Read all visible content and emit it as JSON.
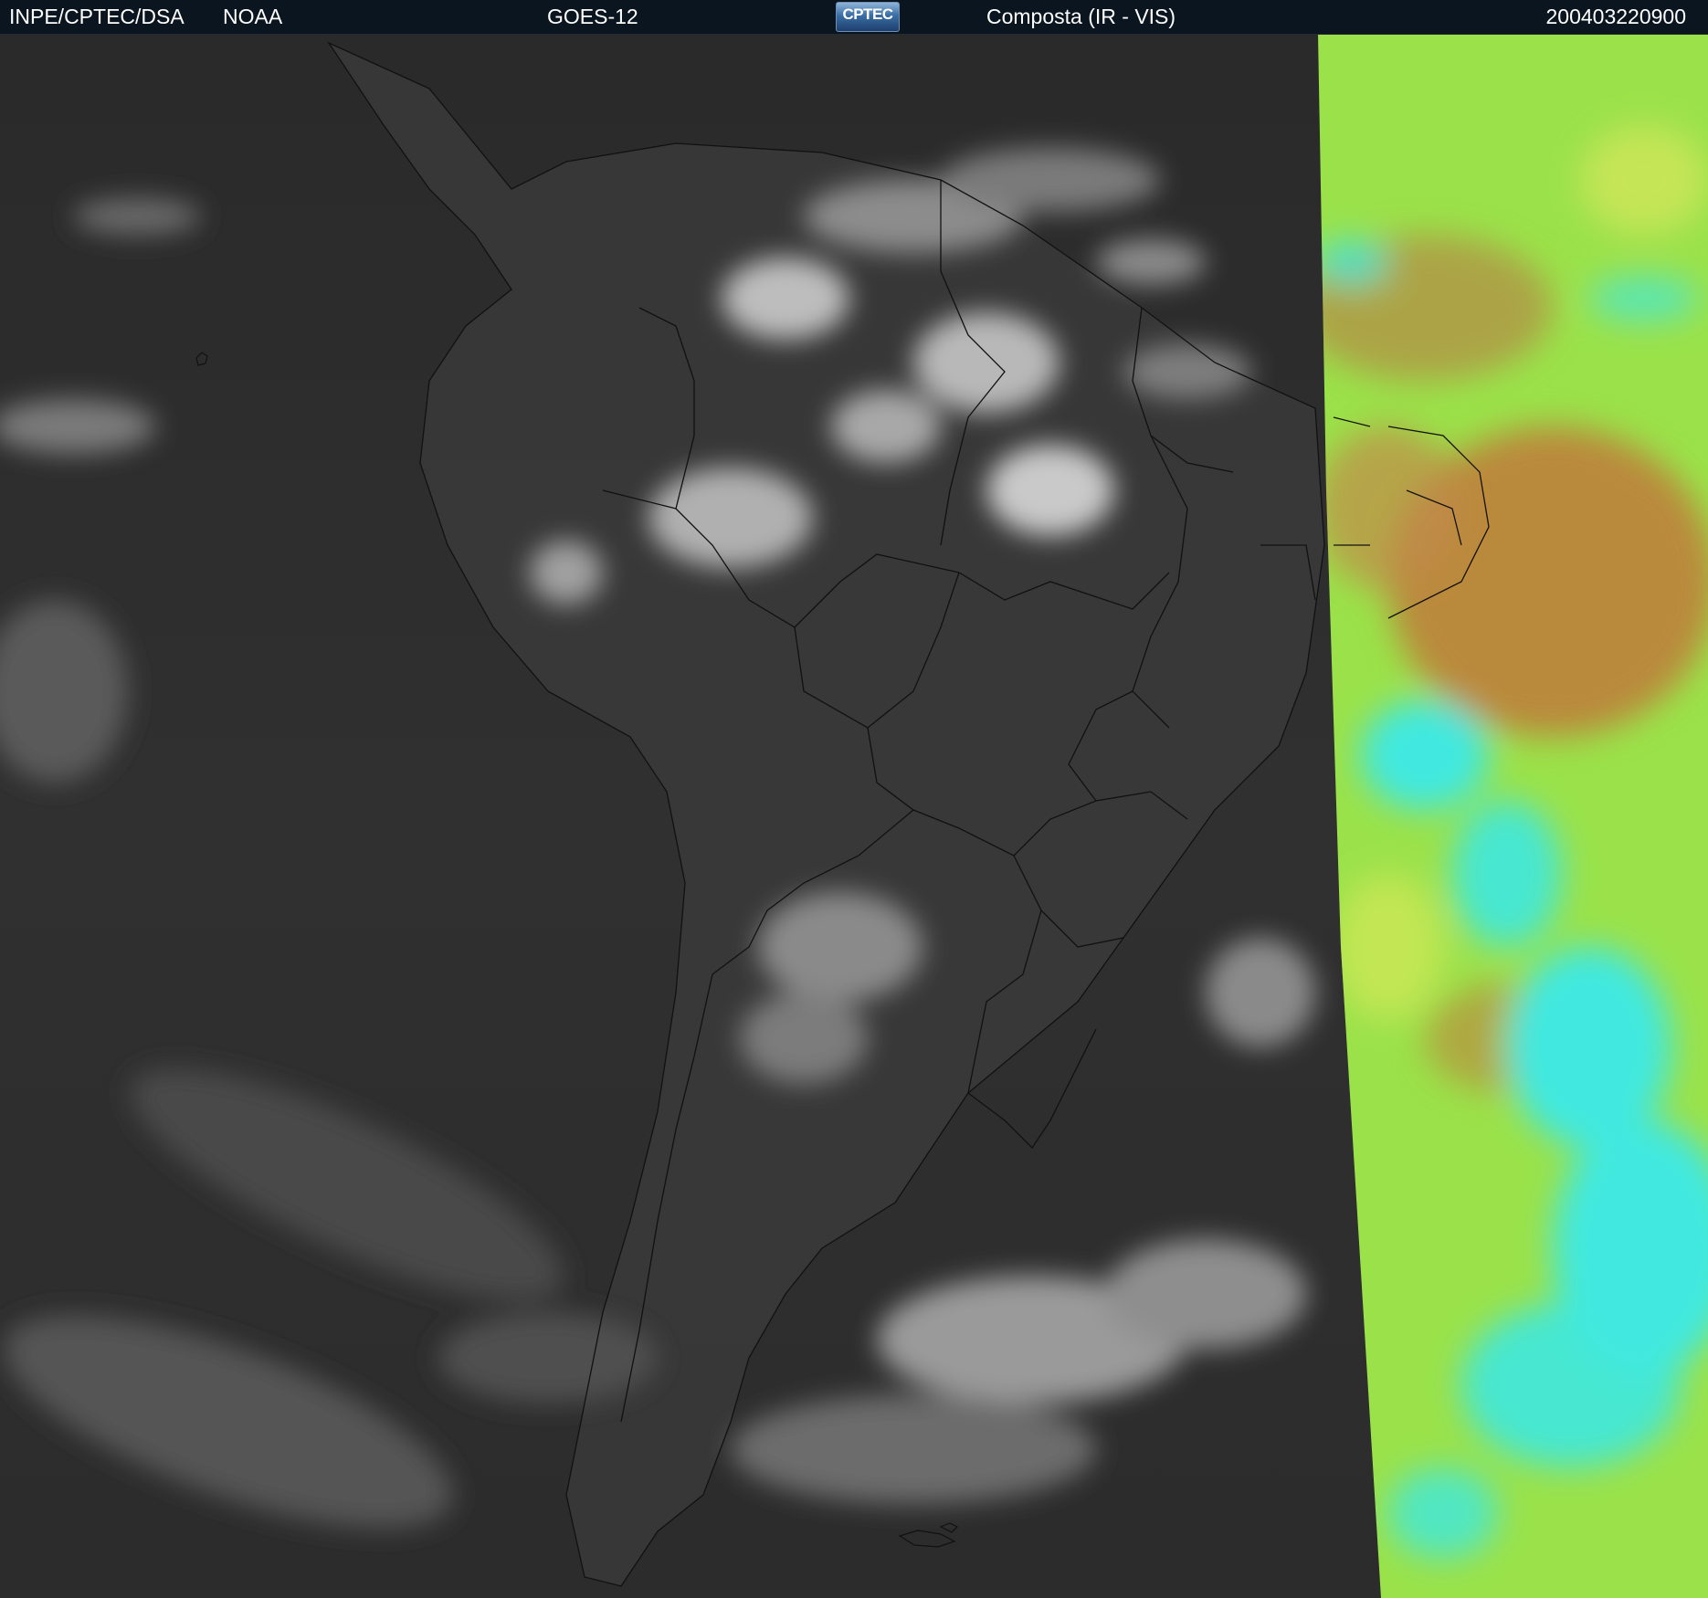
{
  "header": {
    "organization": "INPE/CPTEC/DSA",
    "agency": "NOAA",
    "satellite": "GOES-12",
    "logo_text": "CPTEC",
    "product": "Composta (IR - VIS)",
    "datetime": "200403220900"
  },
  "colors": {
    "header_background": "#0a1520",
    "ir_background": "#2b2b2b",
    "vis_green": "#9be24a",
    "vis_brown": "#c07a3a",
    "vis_cyan": "#3fe8e0"
  }
}
